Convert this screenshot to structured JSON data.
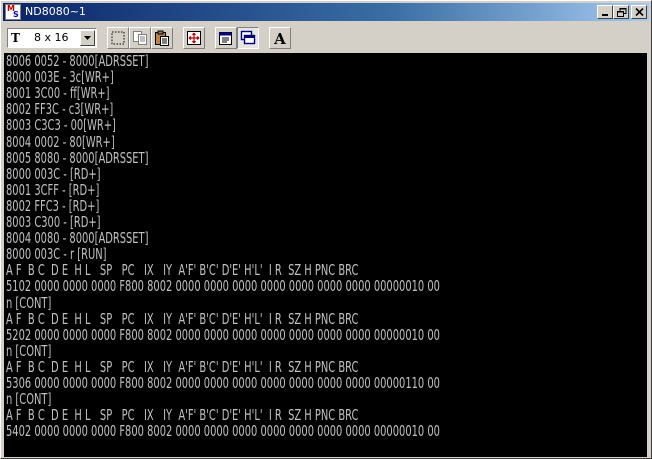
{
  "window": {
    "title": "ND8080~1",
    "icon_letters": [
      "M",
      "S"
    ],
    "controls": [
      "minimize-icon",
      "restore-icon",
      "close-icon"
    ]
  },
  "toolbar": {
    "font_icon": "T",
    "font_value": "8 x 16",
    "buttons": [
      "mark-icon",
      "copy-icon",
      "paste-icon",
      "fullscreen-icon",
      "properties-icon",
      "background-icon",
      "font-icon"
    ],
    "font_button_label": "A"
  },
  "console": {
    "text_color": "#c0c0c0",
    "background": "#000000",
    "lines": [
      "8006 0052 - 8000[ADRSSET]",
      "8000 003E - 3c[WR+]",
      "8001 3C00 - ff[WR+]",
      "8002 FF3C - c3[WR+]",
      "8003 C3C3 - 00[WR+]",
      "8004 0002 - 80[WR+]",
      "8005 8080 - 8000[ADRSSET]",
      "8000 003C - [RD+]",
      "8001 3CFF - [RD+]",
      "8002 FFC3 - [RD+]",
      "8003 C300 - [RD+]",
      "8004 0080 - 8000[ADRSSET]",
      "8000 003C - r [RUN]",
      "A F  B C  D E  H L   SP   PC   IX   IY  A'F' B'C' D'E' H'L'  I R  SZ H PNC BRC",
      "5102 0000 0000 0000 F800 8002 0000 0000 0000 0000 0000 0000 0000 00000010 00",
      "n [CONT]",
      "A F  B C  D E  H L   SP   PC   IX   IY  A'F' B'C' D'E' H'L'  I R  SZ H PNC BRC",
      "5202 0000 0000 0000 F800 8002 0000 0000 0000 0000 0000 0000 0000 00000010 00",
      "n [CONT]",
      "A F  B C  D E  H L   SP   PC   IX   IY  A'F' B'C' D'E' H'L'  I R  SZ H PNC BRC",
      "5306 0000 0000 0000 F800 8002 0000 0000 0000 0000 0000 0000 0000 00000110 00",
      "n [CONT]",
      "A F  B C  D E  H L   SP   PC   IX   IY  A'F' B'C' D'E' H'L'  I R  SZ H PNC BRC",
      "5402 0000 0000 0000 F800 8002 0000 0000 0000 0000 0000 0000 0000 00000010 00"
    ]
  }
}
